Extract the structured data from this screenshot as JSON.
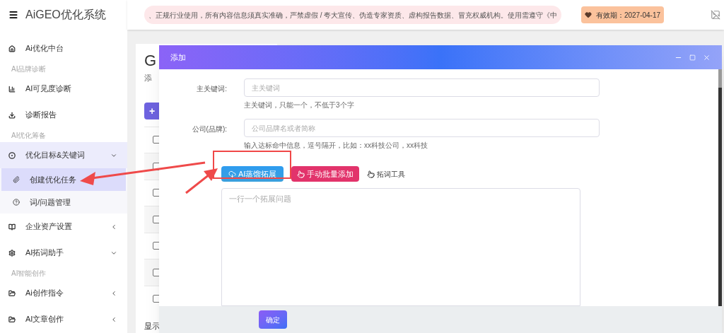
{
  "sidebar": {
    "logo": "AiGEO优化系统",
    "items": [
      {
        "kind": "item",
        "label": "Ai优化中台",
        "selected": false
      },
      {
        "kind": "section",
        "label": "AI品牌诊断"
      },
      {
        "kind": "item",
        "label": "AI可见度诊断",
        "selected": false
      },
      {
        "kind": "item",
        "label": "诊断报告",
        "selected": false
      },
      {
        "kind": "section",
        "label": "AI优化筹备"
      },
      {
        "kind": "item",
        "label": "优化目标&关键词",
        "selected": false,
        "expanded": true,
        "children": [
          {
            "label": "创建优化任务",
            "selected": true
          },
          {
            "label": "词/问题管理",
            "selected": false
          }
        ]
      },
      {
        "kind": "item",
        "label": "企业资产设置",
        "selected": false,
        "expanded": false
      },
      {
        "kind": "item",
        "label": "AI拓词助手",
        "selected": false,
        "expanded": true
      },
      {
        "kind": "section",
        "label": "AI智能创作"
      },
      {
        "kind": "item",
        "label": "Ai创作指令",
        "selected": false,
        "expanded": false
      },
      {
        "kind": "item",
        "label": "AI文章创作",
        "selected": false,
        "expanded": false
      }
    ]
  },
  "header": {
    "notice": "、正规行业使用，所有内容信息须真实准确，严禁虚假 / 夸大宣传、伪造专家资质、虚构报告数据、冒充权威机构。使用需遵守《中",
    "validity": "有效期：2027-04-17"
  },
  "background_page": {
    "title": "G",
    "subtitle": "添",
    "add_button": "+",
    "rows": [
      {
        "checked": false
      },
      {
        "checked": false
      },
      {
        "checked": false
      },
      {
        "checked": false
      },
      {
        "checked": false
      },
      {
        "checked": false
      },
      {
        "checked": false
      }
    ],
    "footer_text": "显示"
  },
  "dialog": {
    "title": "添加",
    "fields": [
      {
        "label": "主关键词:",
        "placeholder": "主关键词",
        "help": "主关键词，只能一个，不低于3个字"
      },
      {
        "label": "公司(品牌):",
        "placeholder": "公司品牌名或者简称",
        "help": "输入达标命中信息，逗号隔开，比如：xx科技公司，xx科技"
      }
    ],
    "buttons": [
      {
        "label": "AI蒸馏拓展",
        "kind": "primary"
      },
      {
        "label": "手动批量添加",
        "kind": "danger"
      },
      {
        "label": "拓词工具",
        "kind": "link"
      }
    ],
    "textarea_placeholder": "一行一个拓展问题",
    "confirm": "确定"
  }
}
